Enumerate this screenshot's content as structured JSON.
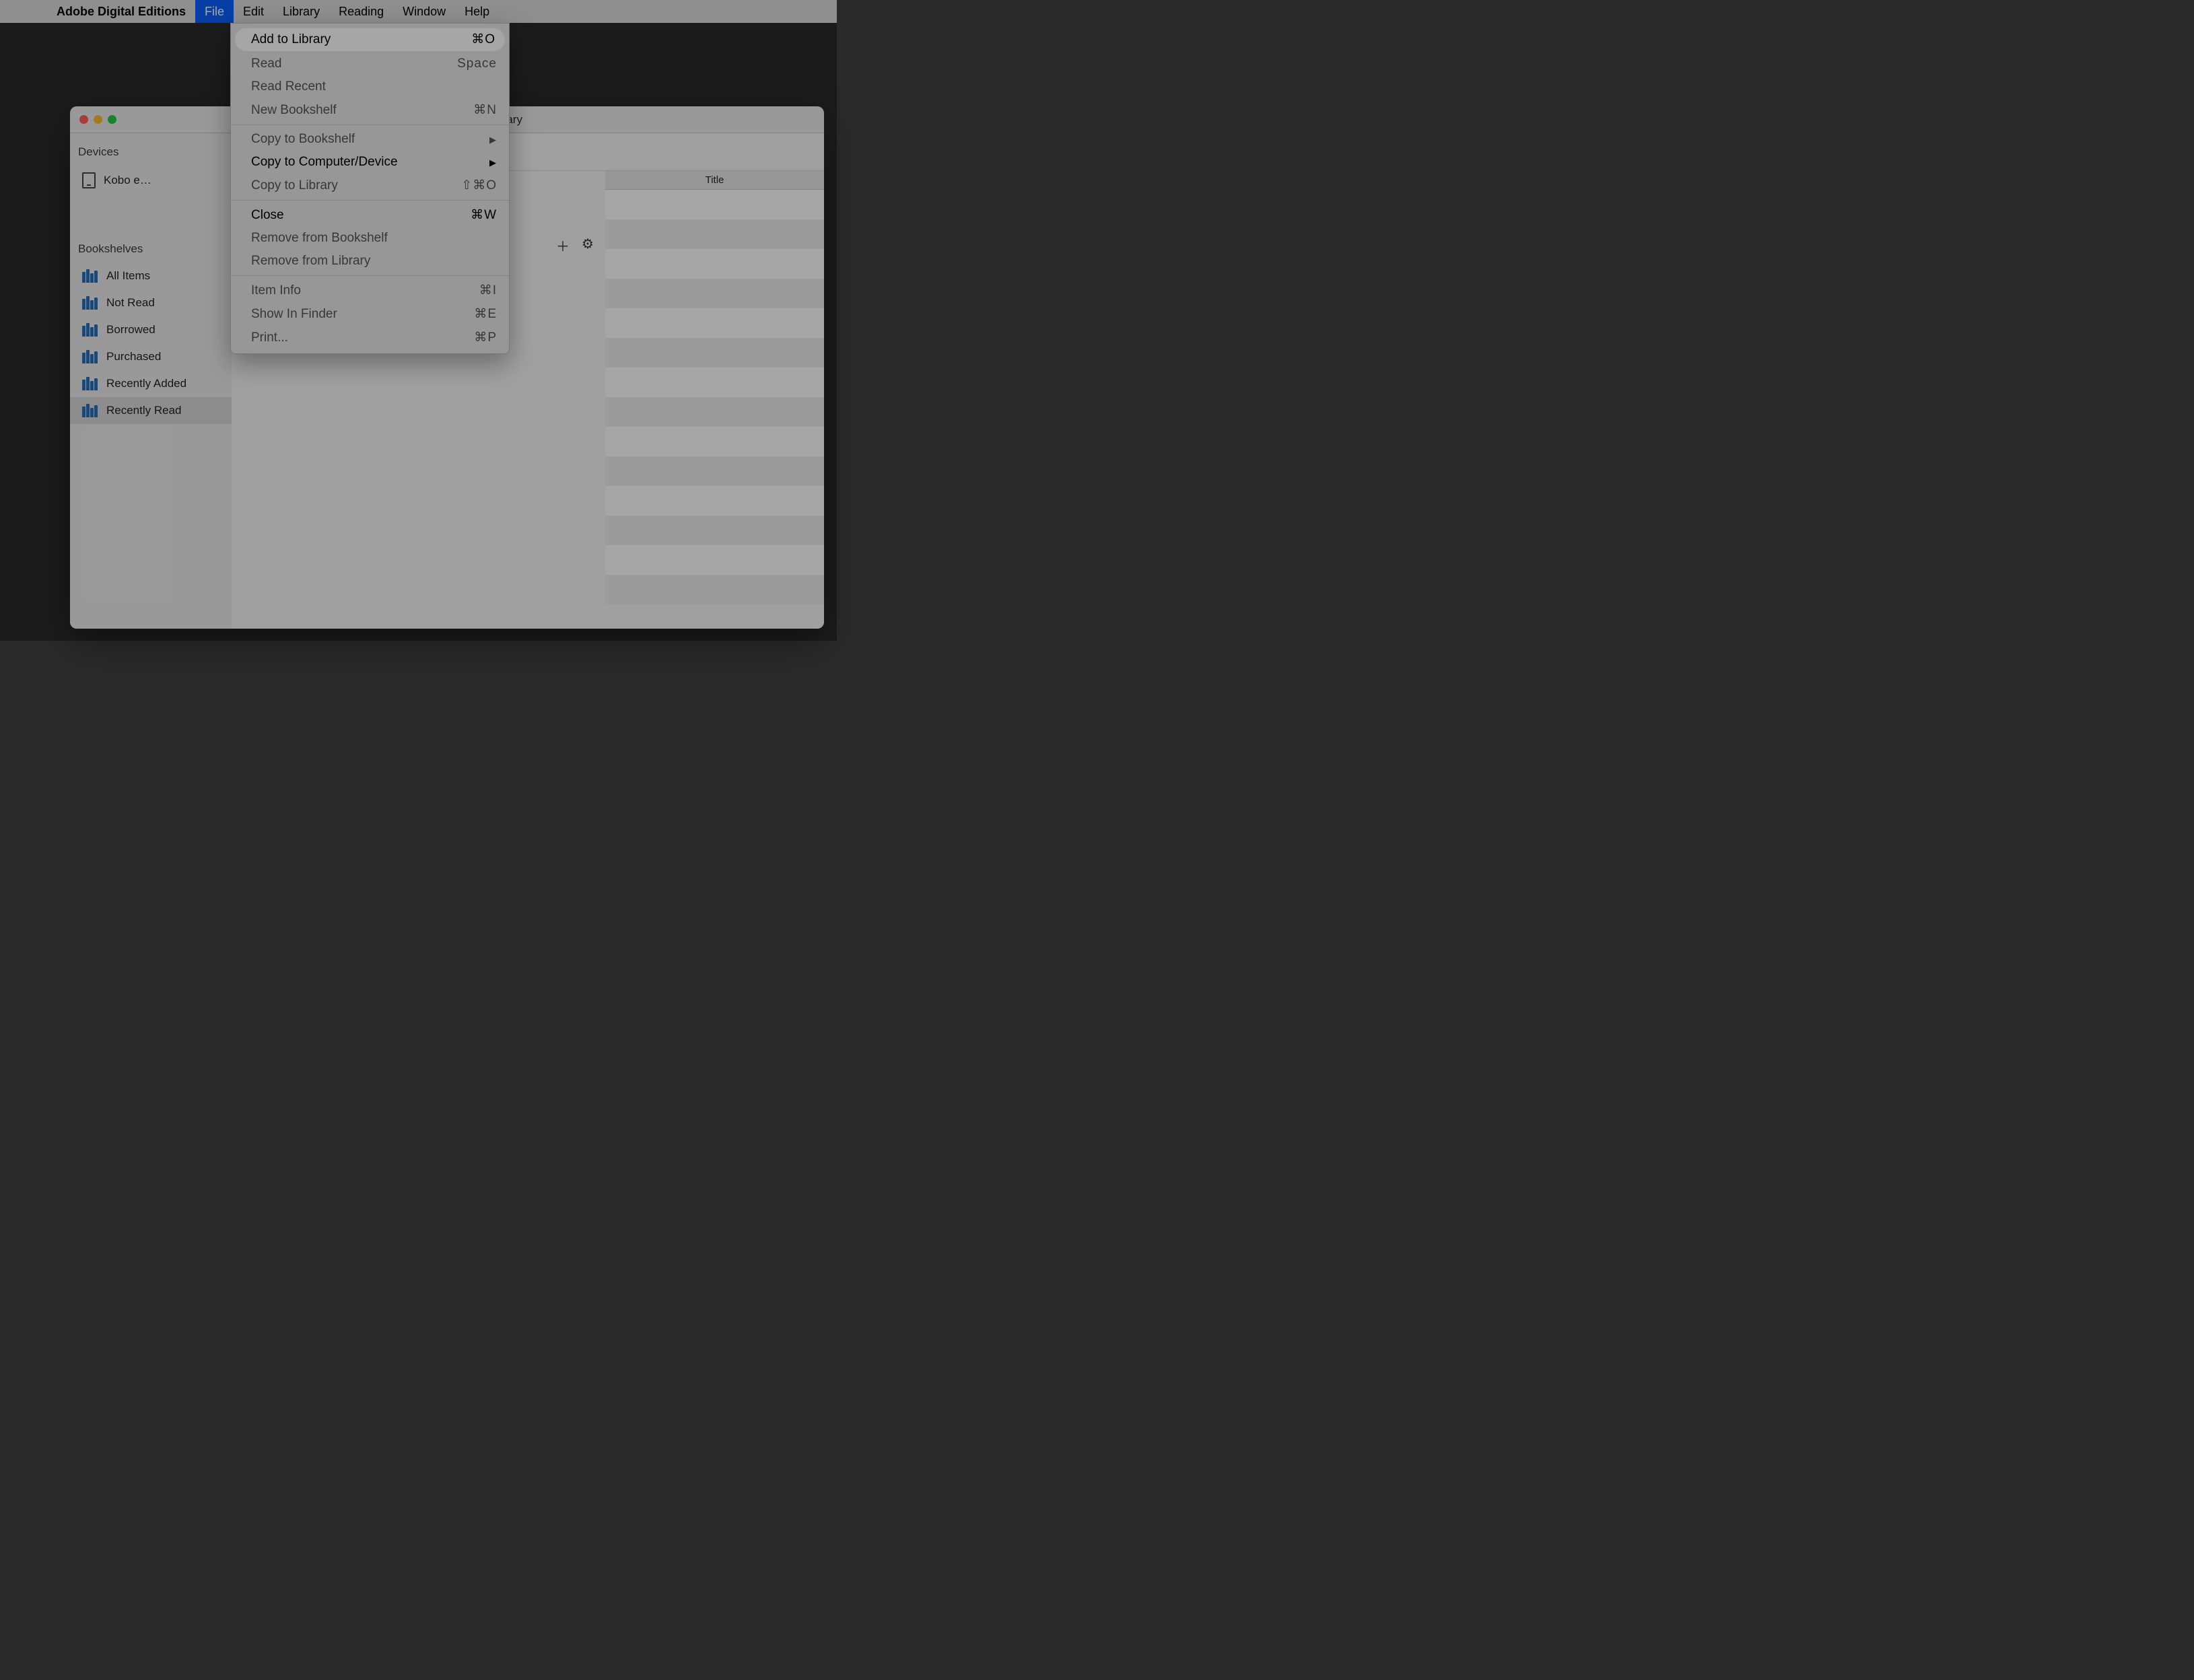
{
  "menubar": {
    "app": "Adobe Digital Editions",
    "items": [
      "File",
      "Edit",
      "Library",
      "Reading",
      "Window",
      "Help"
    ],
    "active_index": 0
  },
  "dropdown": {
    "groups": [
      [
        {
          "label": "Add to Library",
          "shortcut": "⌘O",
          "enabled": true,
          "highlight": true
        },
        {
          "label": "Read",
          "shortcut": "Space",
          "enabled": false
        },
        {
          "label": "Read Recent",
          "shortcut": "",
          "enabled": false
        },
        {
          "label": "New Bookshelf",
          "shortcut": "⌘N",
          "enabled": false
        }
      ],
      [
        {
          "label": "Copy to Bookshelf",
          "shortcut": "",
          "enabled": false,
          "submenu": true
        },
        {
          "label": "Copy to Computer/Device",
          "shortcut": "",
          "enabled": true,
          "submenu": true
        },
        {
          "label": "Copy to Library",
          "shortcut": "⇧⌘O",
          "enabled": false
        }
      ],
      [
        {
          "label": "Close",
          "shortcut": "⌘W",
          "enabled": true
        },
        {
          "label": "Remove from Bookshelf",
          "shortcut": "",
          "enabled": false
        },
        {
          "label": "Remove from Library",
          "shortcut": "",
          "enabled": false
        }
      ],
      [
        {
          "label": "Item Info",
          "shortcut": "⌘I",
          "enabled": false
        },
        {
          "label": "Show In Finder",
          "shortcut": "⌘E",
          "enabled": false
        },
        {
          "label": "Print...",
          "shortcut": "⌘P",
          "enabled": false
        }
      ]
    ]
  },
  "window": {
    "title_suffix": "ibrary",
    "sidebar": {
      "devices_header": "Devices",
      "device": "Kobo e…",
      "bookshelves_header": "Bookshelves",
      "shelves": [
        "All Items",
        "Not Read",
        "Borrowed",
        "Purchased",
        "Recently Added",
        "Recently Read"
      ],
      "selected_shelf_index": 5
    },
    "table": {
      "column": "Title"
    },
    "toolbar": {
      "gear": "⚙︎",
      "select_caret": "⌄",
      "grid": "▦",
      "list": "☰",
      "plus": "＋",
      "gear2": "⚙︎"
    }
  }
}
